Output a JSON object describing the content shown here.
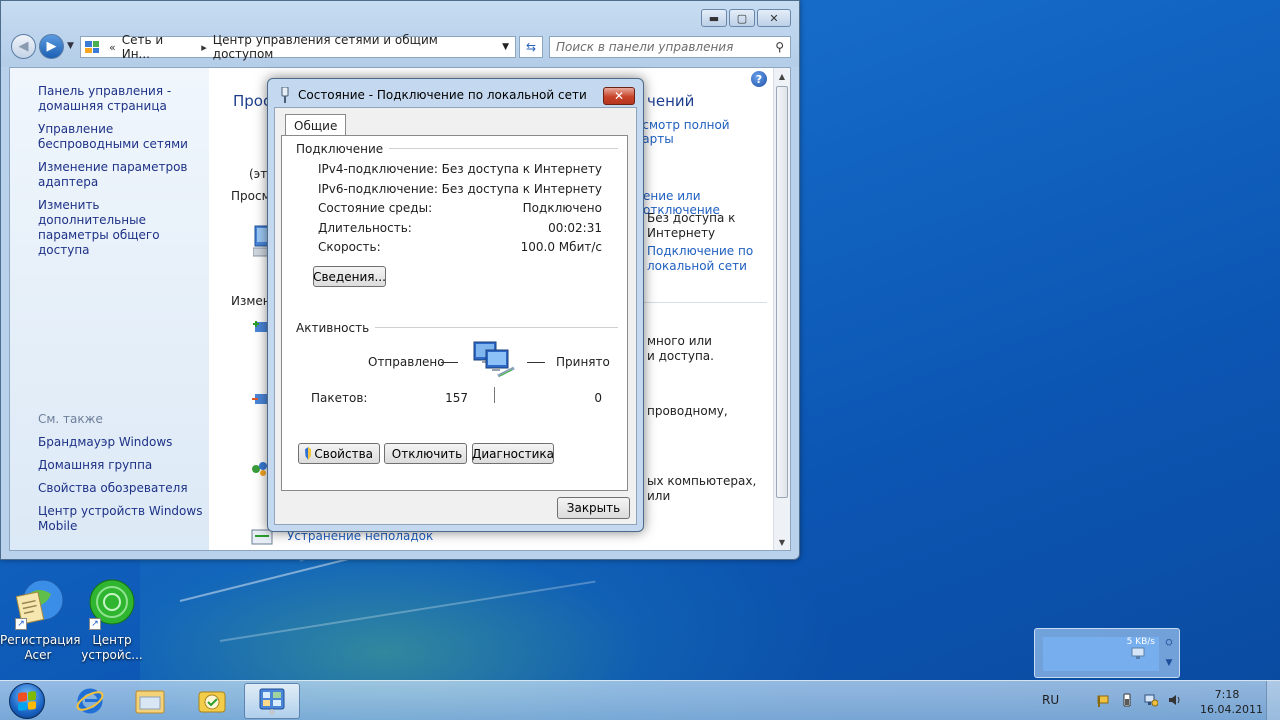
{
  "explorer": {
    "address_breadcrumbs": [
      "Сеть и Ин...",
      "Центр управления сетями и общим доступом"
    ],
    "search_placeholder": "Поиск в панели управления",
    "caption": {
      "minimize": "▬",
      "maximize": "▢",
      "close": "✕"
    },
    "sidebar": {
      "top_links": [
        "Панель управления - домашняя страница",
        "Управление беспроводными сетями",
        "Изменение параметров адаптера",
        "Изменить дополнительные параметры общего доступа"
      ],
      "see_also_title": "См. также",
      "see_also_links": [
        "Брандмауэр Windows",
        "Домашняя группа",
        "Свойства обозревателя",
        "Центр устройств Windows Mobile"
      ]
    },
    "main": {
      "heading_left": "Прос",
      "heading_right": "чений",
      "view_full_map": "осмотр полной карты",
      "eto": "(это",
      "prosm": "Просм",
      "connect_disconnect": "ение или отключение",
      "access_type_value": "Без доступа к Интернету",
      "connection_link": "Подключение по локальной сети",
      "izmen": "Измен",
      "fragment_1": "много или",
      "fragment_2": "и доступа.",
      "fragment_3": "проводному,",
      "fragment_4": "ых компьютерах, или",
      "troubleshoot": "Устранение неполадок"
    }
  },
  "dialog": {
    "title": "Состояние - Подключение по локальной сети",
    "close": "✕",
    "tab": "Общие",
    "connection_group": "Подключение",
    "rows": [
      {
        "label": "IPv4-подключение:",
        "value": "Без доступа к Интернету"
      },
      {
        "label": "IPv6-подключение:",
        "value": "Без доступа к Интернету"
      },
      {
        "label": "Состояние среды:",
        "value": "Подключено"
      },
      {
        "label": "Длительность:",
        "value": "00:02:31"
      },
      {
        "label": "Скорость:",
        "value": "100.0 Мбит/с"
      }
    ],
    "details_button": "Сведения...",
    "activity_group": "Активность",
    "sent_label": "Отправлено",
    "received_label": "Принято",
    "packets_label": "Пакетов:",
    "packets_sent": "157",
    "packets_received": "0",
    "properties_button": "Свойства",
    "disable_button": "Отключить",
    "diagnose_button": "Диагностика",
    "close_button": "Закрыть"
  },
  "desktop": {
    "icons": [
      {
        "label": "Регистрация Acer"
      },
      {
        "label": "Центр устройс..."
      }
    ],
    "gadget_rate": "5 KB/s"
  },
  "taskbar": {
    "language": "RU",
    "time": "7:18",
    "date": "16.04.2011"
  }
}
